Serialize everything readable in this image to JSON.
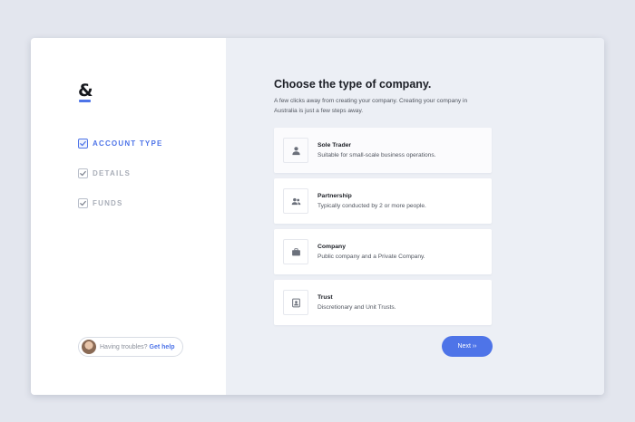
{
  "sidebar": {
    "logo": "&",
    "steps": [
      {
        "label": "ACCOUNT TYPE",
        "active": true
      },
      {
        "label": "DETAILS",
        "active": false
      },
      {
        "label": "FUNDS",
        "active": false
      }
    ],
    "help": {
      "text": "Having troubles?",
      "link": "Get help"
    }
  },
  "main": {
    "title": "Choose the type of company.",
    "subtitle": "A few clicks away from creating your company. Creating your company in Australia is just a few steps away.",
    "options": [
      {
        "title": "Sole Trader",
        "description": "Suitable for small-scale business operations.",
        "icon": "person-icon"
      },
      {
        "title": "Partnership",
        "description": "Typically conducted by 2 or more people.",
        "icon": "people-icon"
      },
      {
        "title": "Company",
        "description": "Public company and a Private Company.",
        "icon": "briefcase-icon"
      },
      {
        "title": "Trust",
        "description": "Discretionary and Unit Trusts.",
        "icon": "id-badge-icon"
      }
    ],
    "next_label": "Next ››"
  },
  "colors": {
    "accent": "#4e74e8",
    "background": "#e3e6ee",
    "panel": "#eceff5"
  }
}
